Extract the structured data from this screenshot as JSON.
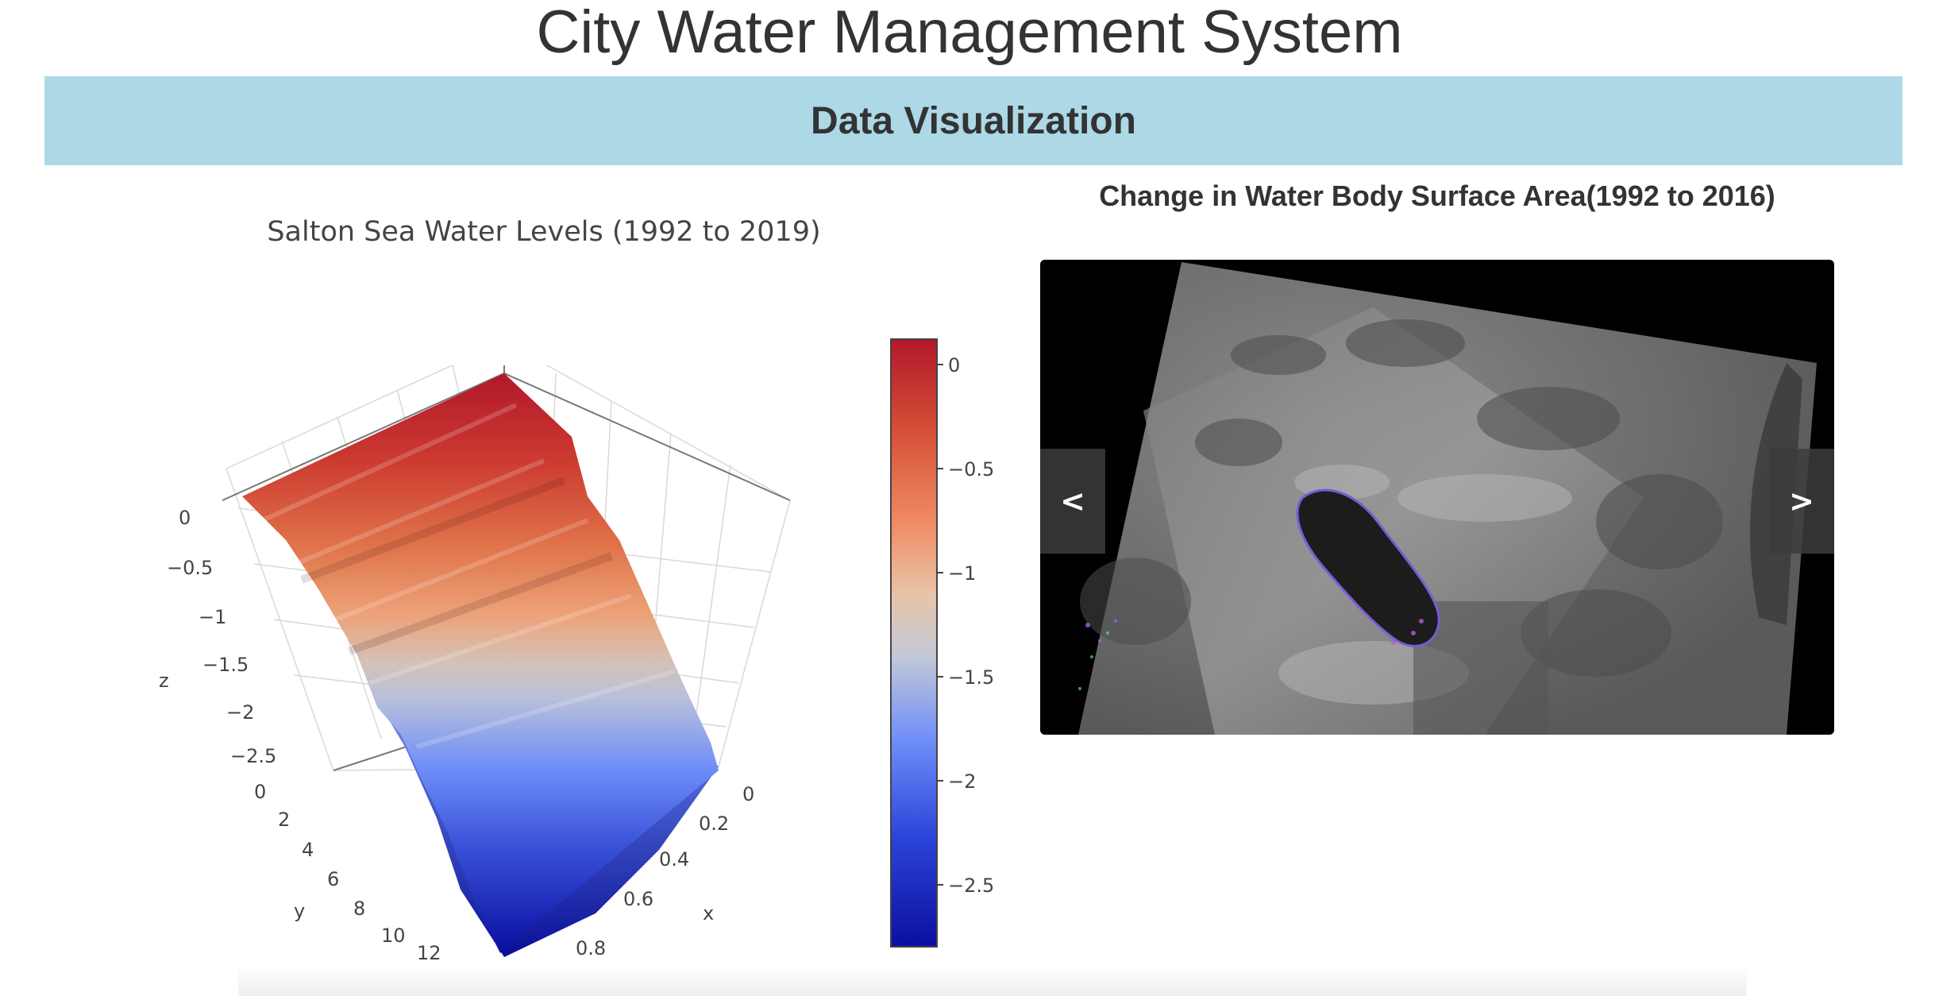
{
  "header": {
    "title": "City Water Management System"
  },
  "section": {
    "title": "Data Visualization"
  },
  "surface_plot": {
    "title": "Salton Sea Water Levels (1992 to 2019)",
    "axes": {
      "x": {
        "label": "x",
        "ticks": [
          "0",
          "0.2",
          "0.4",
          "0.6",
          "0.8"
        ]
      },
      "y": {
        "label": "y",
        "ticks": [
          "0",
          "2",
          "4",
          "6",
          "8",
          "10",
          "12"
        ]
      },
      "z": {
        "label": "z",
        "ticks": [
          "0",
          "−0.5",
          "−1",
          "−1.5",
          "−2",
          "−2.5"
        ]
      }
    },
    "colorbar": {
      "ticks": [
        "0",
        "−0.5",
        "−1",
        "−1.5",
        "−2",
        "−2.5"
      ],
      "colors": [
        "#b2182b",
        "#ef8a62",
        "#e8c4a8",
        "#c4c9d6",
        "#6f8ef8",
        "#1a2fc9",
        "#0a0fa0"
      ]
    }
  },
  "chart_data": {
    "type": "surface",
    "title": "Salton Sea Water Levels (1992 to 2019)",
    "xlabel": "x",
    "ylabel": "y",
    "zlabel": "z",
    "xlim": [
      0,
      1
    ],
    "ylim": [
      0,
      12
    ],
    "zlim": [
      -2.8,
      0.1
    ],
    "y": [
      0,
      1,
      2,
      3,
      4,
      5,
      6,
      7,
      8,
      9,
      10,
      11,
      12
    ],
    "z": [
      0,
      -0.1,
      -0.3,
      -0.4,
      -0.6,
      -0.75,
      -0.95,
      -1.1,
      -1.3,
      -1.5,
      -1.85,
      -2.2,
      -2.75
    ],
    "colorscale": "RdBu (reversed)"
  },
  "gallery": {
    "title": "Change in Water Body Surface Area(1992 to 2016)",
    "prev_label": "<",
    "next_label": ">"
  }
}
